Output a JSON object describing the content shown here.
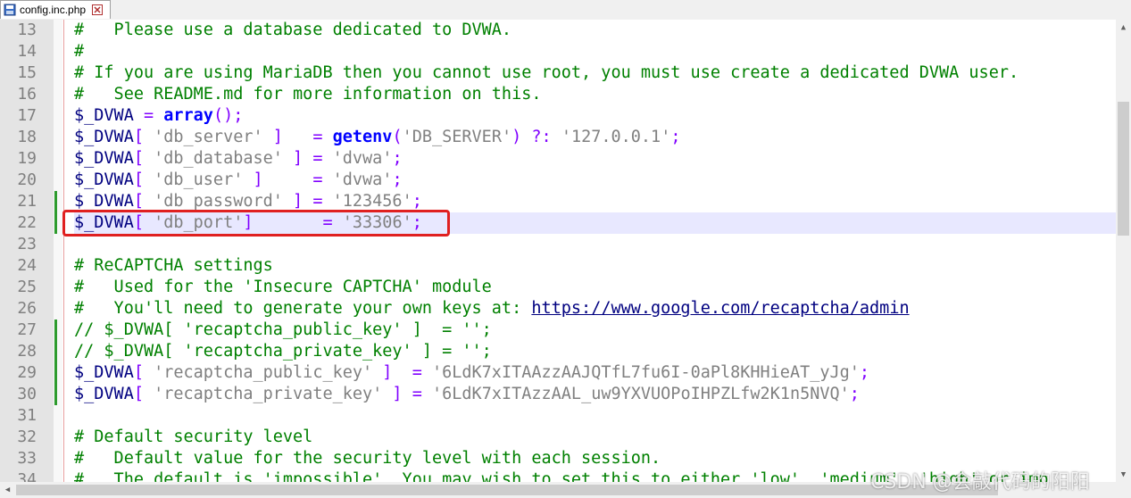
{
  "tab": {
    "label": "config.inc.php",
    "icon": "save-file-icon",
    "close_icon": "close-icon"
  },
  "colors": {
    "comment": "#008000",
    "keyword": "#0000ff",
    "string": "#808080",
    "operator": "#8000ff",
    "highlight_box": "#e02020",
    "current_line": "#e8e8ff"
  },
  "lines": [
    {
      "n": "13",
      "code": [
        [
          "c-comment",
          "#   Please use a database dedicated to DVWA."
        ]
      ]
    },
    {
      "n": "14",
      "code": [
        [
          "c-comment",
          "#"
        ]
      ]
    },
    {
      "n": "15",
      "code": [
        [
          "c-comment",
          "# If you are using MariaDB then you cannot use root, you must use create a dedicated DVWA user."
        ]
      ]
    },
    {
      "n": "16",
      "code": [
        [
          "c-comment",
          "#   See README.md for more information on this."
        ]
      ]
    },
    {
      "n": "17",
      "code": [
        [
          "c-var",
          "$_DVWA "
        ],
        [
          "c-op",
          "= "
        ],
        [
          "c-kw",
          "array"
        ],
        [
          "c-op",
          "();"
        ]
      ]
    },
    {
      "n": "18",
      "code": [
        [
          "c-var",
          "$_DVWA"
        ],
        [
          "c-op",
          "[ "
        ],
        [
          "c-str",
          "'db_server'"
        ],
        [
          "c-op",
          " ]   = "
        ],
        [
          "c-kw",
          "getenv"
        ],
        [
          "c-op",
          "("
        ],
        [
          "c-str",
          "'DB_SERVER'"
        ],
        [
          "c-op",
          ") ?: "
        ],
        [
          "c-str",
          "'127.0.0.1'"
        ],
        [
          "c-op",
          ";"
        ]
      ]
    },
    {
      "n": "19",
      "code": [
        [
          "c-var",
          "$_DVWA"
        ],
        [
          "c-op",
          "[ "
        ],
        [
          "c-str",
          "'db_database'"
        ],
        [
          "c-op",
          " ] = "
        ],
        [
          "c-str",
          "'dvwa'"
        ],
        [
          "c-op",
          ";"
        ]
      ]
    },
    {
      "n": "20",
      "code": [
        [
          "c-var",
          "$_DVWA"
        ],
        [
          "c-op",
          "[ "
        ],
        [
          "c-str",
          "'db_user'"
        ],
        [
          "c-op",
          " ]     = "
        ],
        [
          "c-str",
          "'dvwa'"
        ],
        [
          "c-op",
          ";"
        ]
      ]
    },
    {
      "n": "21",
      "code": [
        [
          "c-var",
          "$_DVWA"
        ],
        [
          "c-op",
          "[ "
        ],
        [
          "c-str",
          "'db_password'"
        ],
        [
          "c-op",
          " ] = "
        ],
        [
          "c-str",
          "'123456'"
        ],
        [
          "c-op",
          ";"
        ]
      ]
    },
    {
      "n": "22",
      "code": [
        [
          "c-var",
          "$_DVWA"
        ],
        [
          "c-op",
          "[ "
        ],
        [
          "c-str",
          "'db_port'"
        ],
        [
          "c-op",
          "]       = "
        ],
        [
          "c-str",
          "'33306'"
        ],
        [
          "c-op",
          ";"
        ]
      ],
      "current": true
    },
    {
      "n": "23",
      "code": []
    },
    {
      "n": "24",
      "code": [
        [
          "c-comment",
          "# ReCAPTCHA settings"
        ]
      ]
    },
    {
      "n": "25",
      "code": [
        [
          "c-comment",
          "#   Used for the 'Insecure CAPTCHA' module"
        ]
      ]
    },
    {
      "n": "26",
      "code": [
        [
          "c-comment",
          "#   You'll need to generate your own keys at: "
        ],
        [
          "c-link",
          "https://www.google.com/recaptcha/admin"
        ]
      ]
    },
    {
      "n": "27",
      "code": [
        [
          "c-comment",
          "// $_DVWA[ 'recaptcha_public_key' ]  = '';"
        ]
      ]
    },
    {
      "n": "28",
      "code": [
        [
          "c-comment",
          "// $_DVWA[ 'recaptcha_private_key' ] = '';"
        ]
      ]
    },
    {
      "n": "29",
      "code": [
        [
          "c-var",
          "$_DVWA"
        ],
        [
          "c-op",
          "[ "
        ],
        [
          "c-str",
          "'recaptcha_public_key'"
        ],
        [
          "c-op",
          " ]  = "
        ],
        [
          "c-str",
          "'6LdK7xITAAzzAAJQTfL7fu6I-0aPl8KHHieAT_yJg'"
        ],
        [
          "c-op",
          ";"
        ]
      ]
    },
    {
      "n": "30",
      "code": [
        [
          "c-var",
          "$_DVWA"
        ],
        [
          "c-op",
          "[ "
        ],
        [
          "c-str",
          "'recaptcha_private_key'"
        ],
        [
          "c-op",
          " ] = "
        ],
        [
          "c-str",
          "'6LdK7xITAzzAAL_uw9YXVUOPoIHPZLfw2K1n5NVQ'"
        ],
        [
          "c-op",
          ";"
        ]
      ]
    },
    {
      "n": "31",
      "code": []
    },
    {
      "n": "32",
      "code": [
        [
          "c-comment",
          "# Default security level"
        ]
      ]
    },
    {
      "n": "33",
      "code": [
        [
          "c-comment",
          "#   Default value for the security level with each session."
        ]
      ]
    },
    {
      "n": "34",
      "code": [
        [
          "c-comment",
          "#   The default is 'impossible'. You may wish to set this to either 'low', 'medium', 'high' or imp"
        ]
      ]
    }
  ],
  "watermark": "CSDN @会敲代码的阳阳"
}
